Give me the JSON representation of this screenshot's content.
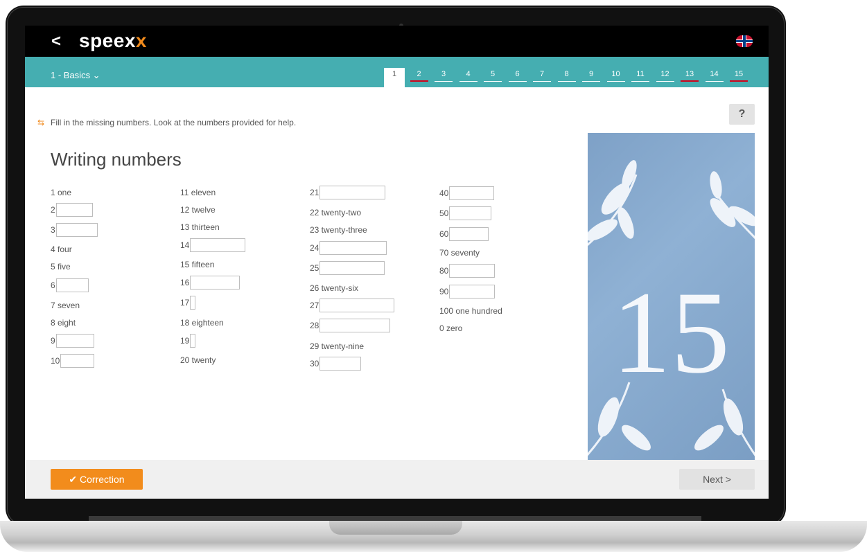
{
  "app": {
    "logo_main": "speex",
    "logo_accent": "x",
    "back_symbol": "<"
  },
  "lesson_selector": {
    "label": "1 - Basics ⌄"
  },
  "pagination": {
    "pages": [
      "1",
      "2",
      "3",
      "4",
      "5",
      "6",
      "7",
      "8",
      "9",
      "10",
      "11",
      "12",
      "13",
      "14",
      "15"
    ],
    "active": "1"
  },
  "instruction": {
    "icon": "⇆",
    "text": "Fill in the missing numbers. Look at the numbers provided for help."
  },
  "help_label": "?",
  "title": "Writing numbers",
  "col1": [
    {
      "num": "1 one"
    },
    {
      "num": "2",
      "input": true
    },
    {
      "num": "3",
      "input": true
    },
    {
      "num": "4 four"
    },
    {
      "num": "5 five"
    },
    {
      "num": "6",
      "input": true
    },
    {
      "num": "7 seven"
    },
    {
      "num": "8 eight"
    },
    {
      "num": "9",
      "input": true
    },
    {
      "num": "10",
      "input": true
    }
  ],
  "col2": [
    {
      "num": "11 eleven"
    },
    {
      "num": "12 twelve"
    },
    {
      "num": "13 thirteen"
    },
    {
      "num": "14",
      "input": true
    },
    {
      "num": "15 fifteen"
    },
    {
      "num": "16",
      "input": true
    },
    {
      "num": "17",
      "input": true
    },
    {
      "num": "18 eighteen"
    },
    {
      "num": "19",
      "input": true
    },
    {
      "num": "20 twenty"
    }
  ],
  "col3": [
    {
      "num": "21",
      "input": true
    },
    {
      "num": "22 twenty-two"
    },
    {
      "num": "23 twenty-three"
    },
    {
      "num": "24",
      "input": true
    },
    {
      "num": "25",
      "input": true
    },
    {
      "num": "26 twenty-six"
    },
    {
      "num": "27",
      "input": true
    },
    {
      "num": "28",
      "input": true
    },
    {
      "num": "29 twenty-nine"
    },
    {
      "num": "30",
      "input": true
    }
  ],
  "col4": [
    {
      "num": "40",
      "input": true
    },
    {
      "num": "50",
      "input": true
    },
    {
      "num": "60",
      "input": true
    },
    {
      "num": "70 seventy"
    },
    {
      "num": "80",
      "input": true
    },
    {
      "num": "90",
      "input": true
    },
    {
      "num": "100 one hundred"
    },
    {
      "num": "0 zero"
    }
  ],
  "image": {
    "big_number": "15"
  },
  "footer": {
    "correction_icon": "✔",
    "correction_label": "Correction",
    "next_label": "Next",
    "next_icon": ">"
  }
}
